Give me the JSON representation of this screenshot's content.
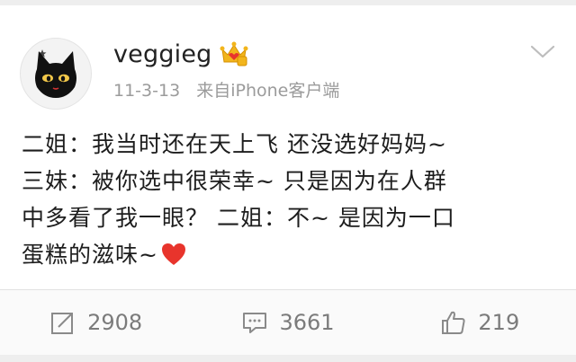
{
  "post": {
    "username": "veggieg",
    "time": "11-3-13",
    "source": "来自iPhone客户端",
    "text_lines": [
      "二姐：我当时还在天上飞 还没选好妈妈~",
      "三妹：被你选中很荣幸~ 只是因为在人群",
      "中多看了我一眼？ 二姐：不~ 是因为一口",
      "蛋糕的滋味~"
    ],
    "trailing_icon": "heart-icon"
  },
  "actions": {
    "repost": {
      "icon": "repost-icon",
      "count": "2908"
    },
    "comment": {
      "icon": "comment-icon",
      "count": "3661"
    },
    "like": {
      "icon": "thumbs-up-icon",
      "count": "219"
    }
  },
  "icons": {
    "avatar": "black-cat-avatar",
    "badge": "vip-crown-icon",
    "menu": "chevron-down-icon"
  },
  "colors": {
    "heart": "#e8342c",
    "badge": "#f2b51c",
    "meta_text": "#9b9b9b",
    "action_text": "#7b7b7b"
  }
}
